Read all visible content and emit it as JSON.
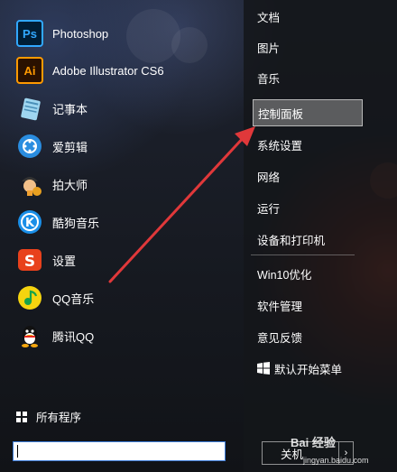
{
  "apps": [
    {
      "label": "Photoshop",
      "icon": "photoshop-icon"
    },
    {
      "label": "Adobe Illustrator CS6",
      "icon": "illustrator-icon"
    },
    {
      "label": "记事本",
      "icon": "notepad-icon"
    },
    {
      "label": "爱剪辑",
      "icon": "aijianji-icon"
    },
    {
      "label": "拍大师",
      "icon": "paidashi-icon"
    },
    {
      "label": "酷狗音乐",
      "icon": "kugou-icon"
    },
    {
      "label": "设置",
      "icon": "settings-app-icon"
    },
    {
      "label": "QQ音乐",
      "icon": "qqmusic-icon"
    },
    {
      "label": "腾讯QQ",
      "icon": "qq-icon"
    }
  ],
  "all_programs": "所有程序",
  "search": {
    "value": "",
    "placeholder": ""
  },
  "right_items": [
    {
      "label": "文档"
    },
    {
      "label": "图片"
    },
    {
      "label": "音乐"
    },
    {
      "label": "控制面板",
      "selected": true
    },
    {
      "label": "系统设置"
    },
    {
      "label": "网络"
    },
    {
      "label": "运行"
    },
    {
      "label": "设备和打印机"
    },
    {
      "label": "Win10优化"
    },
    {
      "label": "软件管理"
    },
    {
      "label": "意见反馈"
    },
    {
      "label": "默认开始菜单",
      "icon": "windows-icon"
    }
  ],
  "shutdown_label": "关机",
  "shutdown_arrow": "›",
  "watermark": {
    "main": "Bai 经验",
    "sub": "jingyan.baidu.com"
  },
  "colors": {
    "accent": "#3b7bd8",
    "arrow": "#e0383a",
    "photoshop": "#31a8ff",
    "illustrator": "#ff9a00"
  }
}
